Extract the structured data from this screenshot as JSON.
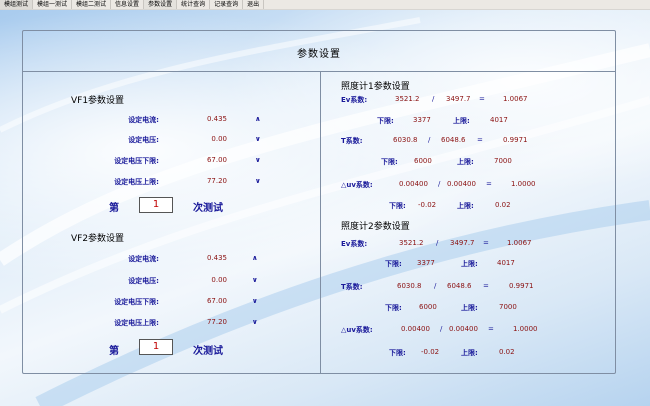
{
  "menu": [
    "模组测试",
    "模组一测试",
    "模组二测试",
    "信息设置",
    "参数设置",
    "统计查询",
    "记录查询",
    "退出"
  ],
  "title": "参数设置",
  "vf1": {
    "title": "VF1参数设置",
    "current_label": "设定电流:",
    "current": "0.435",
    "current_arrow": "∧",
    "voltage_label": "设定电压:",
    "voltage": "0.00",
    "voltage_arrow": "∨",
    "vlow_label": "设定电压下限:",
    "vlow": "67.00",
    "vlow_arrow": "∨",
    "vhigh_label": "设定电压上限:",
    "vhigh": "77.20",
    "vhigh_arrow": "∨",
    "count_prefix": "第",
    "count": "1",
    "count_suffix": "次测试"
  },
  "vf2": {
    "title": "VF2参数设置",
    "current_label": "设定电流:",
    "current": "0.435",
    "current_arrow": "∧",
    "voltage_label": "设定电压:",
    "voltage": "0.00",
    "voltage_arrow": "∨",
    "vlow_label": "设定电压下限:",
    "vlow": "67.00",
    "vlow_arrow": "∨",
    "vhigh_label": "设定电压上限:",
    "vhigh": "77.20",
    "vhigh_arrow": "∨",
    "count_prefix": "第",
    "count": "1",
    "count_suffix": "次测试"
  },
  "lux1": {
    "title": "照度计1参数设置",
    "ev_label": "Ev系数:",
    "ev_a": "3521.2",
    "ev_b": "3497.7",
    "ev_ratio": "1.0067",
    "ev_low_label": "下限:",
    "ev_low": "3377",
    "ev_high_label": "上限:",
    "ev_high": "4017",
    "t_label": "T系数:",
    "t_a": "6030.8",
    "t_b": "6048.6",
    "t_ratio": "0.9971",
    "t_low_label": "下限:",
    "t_low": "6000",
    "t_high_label": "上限:",
    "t_high": "7000",
    "uv_label": "△uv系数:",
    "uv_a": "0.00400",
    "uv_b": "0.00400",
    "uv_ratio": "1.0000",
    "uv_low_label": "下限:",
    "uv_low": "-0.02",
    "uv_high_label": "上限:",
    "uv_high": "0.02",
    "slash": "/",
    "eq": "="
  },
  "lux2": {
    "title": "照度计2参数设置",
    "ev_label": "Ev系数:",
    "ev_a": "3521.2",
    "ev_b": "3497.7",
    "ev_ratio": "1.0067",
    "ev_low_label": "下限:",
    "ev_low": "3377",
    "ev_high_label": "上限:",
    "ev_high": "4017",
    "t_label": "T系数:",
    "t_a": "6030.8",
    "t_b": "6048.6",
    "t_ratio": "0.9971",
    "t_low_label": "下限:",
    "t_low": "6000",
    "t_high_label": "上限:",
    "t_high": "7000",
    "uv_label": "△uv系数:",
    "uv_a": "0.00400",
    "uv_b": "0.00400",
    "uv_ratio": "1.0000",
    "uv_low_label": "下限:",
    "uv_low": "-0.02",
    "uv_high_label": "上限:",
    "uv_high": "0.02",
    "slash": "/",
    "eq": "="
  }
}
